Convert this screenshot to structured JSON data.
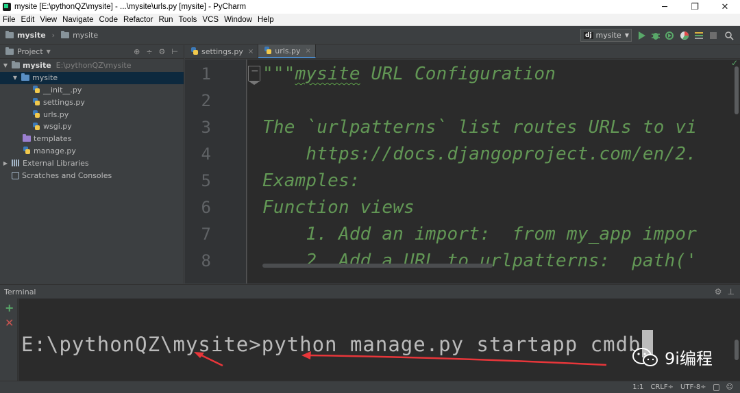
{
  "window": {
    "title": "mysite [E:\\pythonQZ\\mysite] - ...\\mysite\\urls.py [mysite] - PyCharm",
    "minimize": "─",
    "maximize": "❐",
    "close": "✕"
  },
  "menu": [
    "File",
    "Edit",
    "View",
    "Navigate",
    "Code",
    "Refactor",
    "Run",
    "Tools",
    "VCS",
    "Window",
    "Help"
  ],
  "breadcrumb": {
    "root": "mysite",
    "child": "mysite"
  },
  "run_config": {
    "badge": "dj",
    "name": "mysite"
  },
  "project_panel": {
    "title": "Project",
    "root": {
      "name": "mysite",
      "path": "E:\\pythonQZ\\mysite"
    },
    "package": "mysite",
    "files": [
      "__init__.py",
      "settings.py",
      "urls.py",
      "wsgi.py"
    ],
    "templates": "templates",
    "manage": "manage.py",
    "external": "External Libraries",
    "scratches": "Scratches and Consoles"
  },
  "editor": {
    "tabs": [
      {
        "name": "settings.py",
        "active": false
      },
      {
        "name": "urls.py",
        "active": true
      }
    ],
    "line_numbers": [
      "1",
      "2",
      "3",
      "4",
      "5",
      "6",
      "7",
      "8"
    ],
    "lines": {
      "l1_quotes": "\"\"\"",
      "l1_mysite": "mysite",
      "l1_rest": " URL Configuration",
      "l3": "The `urlpatterns` list routes URLs to vi",
      "l4": "    https://docs.djangoproject.com/en/2.",
      "l5": "Examples:",
      "l6": "Function views",
      "l7": "    1. Add an import:  from my_app impor",
      "l8": "    2. Add a URL to urlpatterns:  path('"
    }
  },
  "terminal": {
    "title": "Terminal",
    "prompt": "E:\\pythonQZ\\mysite>",
    "command": "python manage.py startapp cmdb"
  },
  "watermark": "9i编程",
  "status": {
    "position": "1:1",
    "line_sep": "CRLF÷",
    "encoding": "UTF-8÷"
  },
  "colors": {
    "docstring": "#629755",
    "editor_bg": "#2b2b2b",
    "annotation_arrow": "#e8363a"
  }
}
